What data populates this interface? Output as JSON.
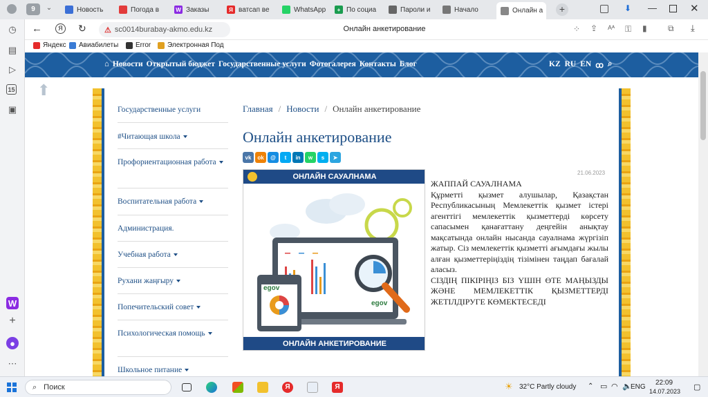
{
  "tabs": [
    {
      "label": "Новость",
      "color": "#3b6fd6"
    },
    {
      "label": "Погода в",
      "color": "#e23b3b"
    },
    {
      "label": "Заказы",
      "color": "#8b2be2",
      "glyph": "W"
    },
    {
      "label": "ватсап ве",
      "color": "#e52b2b",
      "glyph": "Я"
    },
    {
      "label": "WhatsApp",
      "color": "#25d366"
    },
    {
      "label": "По социа",
      "color": "#1a9c4f",
      "glyph": "+"
    },
    {
      "label": "Пароли и",
      "color": "#666666"
    },
    {
      "label": "Начало",
      "color": "#777777"
    },
    {
      "label": "Онлайн а",
      "color": "#888888"
    }
  ],
  "tab_count": "9",
  "address": {
    "url": "sc0014burabay-akmo.edu.kz",
    "page_title": "Онлайн анкетирование"
  },
  "bookmarks": [
    {
      "label": "Яндекс",
      "color": "#e52b2b"
    },
    {
      "label": "Авиабилеты",
      "color": "#3a7bd5"
    },
    {
      "label": "Error",
      "color": "#333333"
    },
    {
      "label": "Электронная Под",
      "color": "#e0a020"
    }
  ],
  "site": {
    "nav": [
      "Новости",
      "Открытый бюджет",
      "Государственные услуги",
      "Фотогалерея",
      "Контакты",
      "Блог"
    ],
    "langs": [
      "KZ",
      "RU",
      "EN"
    ],
    "accessibility_icon": "glasses-icon",
    "search_icon": "search-icon",
    "header_color": "#1d5ea0"
  },
  "sidebar": [
    {
      "label": "Государственные услуги",
      "dropdown": false
    },
    {
      "label": "#Читающая школа",
      "dropdown": true
    },
    {
      "label": "Профориентационная работа",
      "dropdown": true
    },
    {
      "label": "Воспитательная работа",
      "dropdown": true
    },
    {
      "label": "Администрация.",
      "dropdown": false
    },
    {
      "label": "Учебная работа",
      "dropdown": true
    },
    {
      "label": "Рухани жаңғыру",
      "dropdown": true
    },
    {
      "label": "Попечительский совет",
      "dropdown": true
    },
    {
      "label": "Психологическая помощь",
      "dropdown": true
    },
    {
      "label": "Школьное питание",
      "dropdown": true
    }
  ],
  "breadcrumb": {
    "home": "Главная",
    "section": "Новости",
    "current": "Онлайн анкетирование",
    "sep": "/"
  },
  "article": {
    "title": "Онлайн анкетирование",
    "date": "21.06.2023",
    "heading": "ЖАППАЙ САУАЛНАМА",
    "body": "Құрметті қызмет алушылар, Қазақстан Республикасының Мемлекеттік қызмет істері агенттігі мемлекеттік қызметтерді көрсету сапасымен қанағаттану деңгейін анықтау мақсатында онлайн нысанда сауалнама жүргізіп жатыр. Сіз мемлекеттік қызметті ағымдағы жылы алған қызметтеріңіздің тізімінен таңдап бағалай аласыз.",
    "closing": "СІЗДІҢ ПІКІРІҢІЗ БІЗ ҮШІН ӨТЕ МАҢЫЗДЫ ЖӘНЕ МЕМЛЕКЕТТІК ҚЫЗМЕТТЕРДІ ЖЕТІЛДІРУГЕ КӨМЕКТЕСЕДІ",
    "image_top": "ОНЛАЙН САУАЛНАМА",
    "image_bottom": "ОНЛАЙН АНКЕТИРОВАНИЕ",
    "egov": "egov"
  },
  "share": [
    {
      "name": "vk",
      "color": "#4a76a8",
      "glyph": "vk"
    },
    {
      "name": "ok",
      "color": "#ee8208",
      "glyph": "ok"
    },
    {
      "name": "moimir",
      "color": "#168de2",
      "glyph": "@"
    },
    {
      "name": "twitter",
      "color": "#03a9f4",
      "glyph": "t"
    },
    {
      "name": "linkedin",
      "color": "#0077b5",
      "glyph": "in"
    },
    {
      "name": "whatsapp",
      "color": "#25d366",
      "glyph": "w"
    },
    {
      "name": "skype",
      "color": "#00aff0",
      "glyph": "s"
    },
    {
      "name": "telegram",
      "color": "#2ca5e0",
      "glyph": "➤"
    }
  ],
  "taskbar": {
    "search": "Поиск",
    "weather": "32°C  Partly cloudy",
    "lang": "ENG",
    "time": "22:09",
    "date": "14.07.2023"
  }
}
